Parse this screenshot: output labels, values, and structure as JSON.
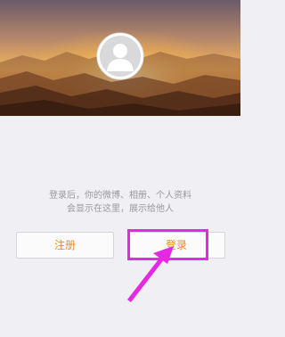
{
  "profile_header": {
    "avatar_icon": "default-avatar-icon",
    "background": "sunset-mountains"
  },
  "hint": {
    "line1": "登录后，你的微博、相册、个人资料",
    "line2": "会显示在这里，展示给他人"
  },
  "buttons": {
    "register_label": "注册",
    "login_label": "登录"
  },
  "annotation": {
    "highlight_color": "#e428e4",
    "arrow_color": "#e428e4"
  },
  "colors": {
    "accent": "#f08c1e",
    "page_background": "#f0eff4"
  }
}
